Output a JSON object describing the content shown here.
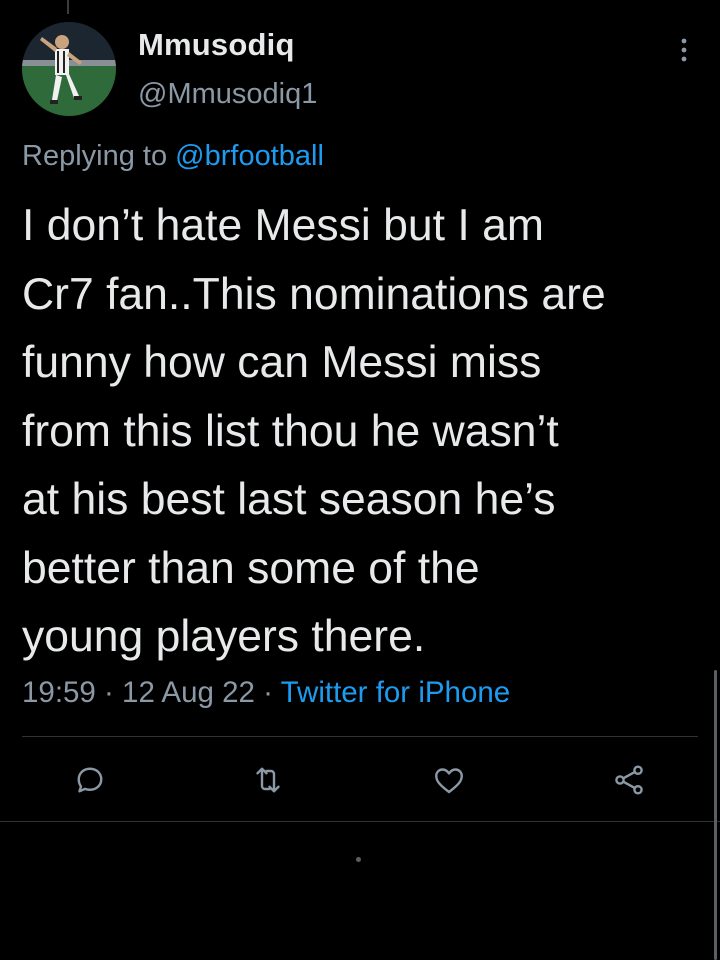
{
  "tweet": {
    "display_name": "Mmusodiq",
    "handle": "@Mmusodiq1",
    "replying_prefix": "Replying to ",
    "replying_to": "@brfootball",
    "text": "I don’t hate Messi but I am\nCr7 fan..This nominations are\nfunny how can Messi miss\nfrom this list thou he wasn’t\nat his best last season he’s\nbetter than some of the\nyoung players there.",
    "time": "19:59",
    "separator": " · ",
    "date": "12 Aug 22",
    "source": "Twitter for iPhone"
  },
  "icons": {
    "more": "more-vertical-icon",
    "reply": "reply-icon",
    "retweet": "retweet-icon",
    "like": "like-icon",
    "share": "share-icon"
  },
  "colors": {
    "background": "#000000",
    "text_primary": "#e7e9ea",
    "text_secondary": "#8b98a5",
    "accent": "#1d9bf0",
    "divider": "#2f3336"
  }
}
